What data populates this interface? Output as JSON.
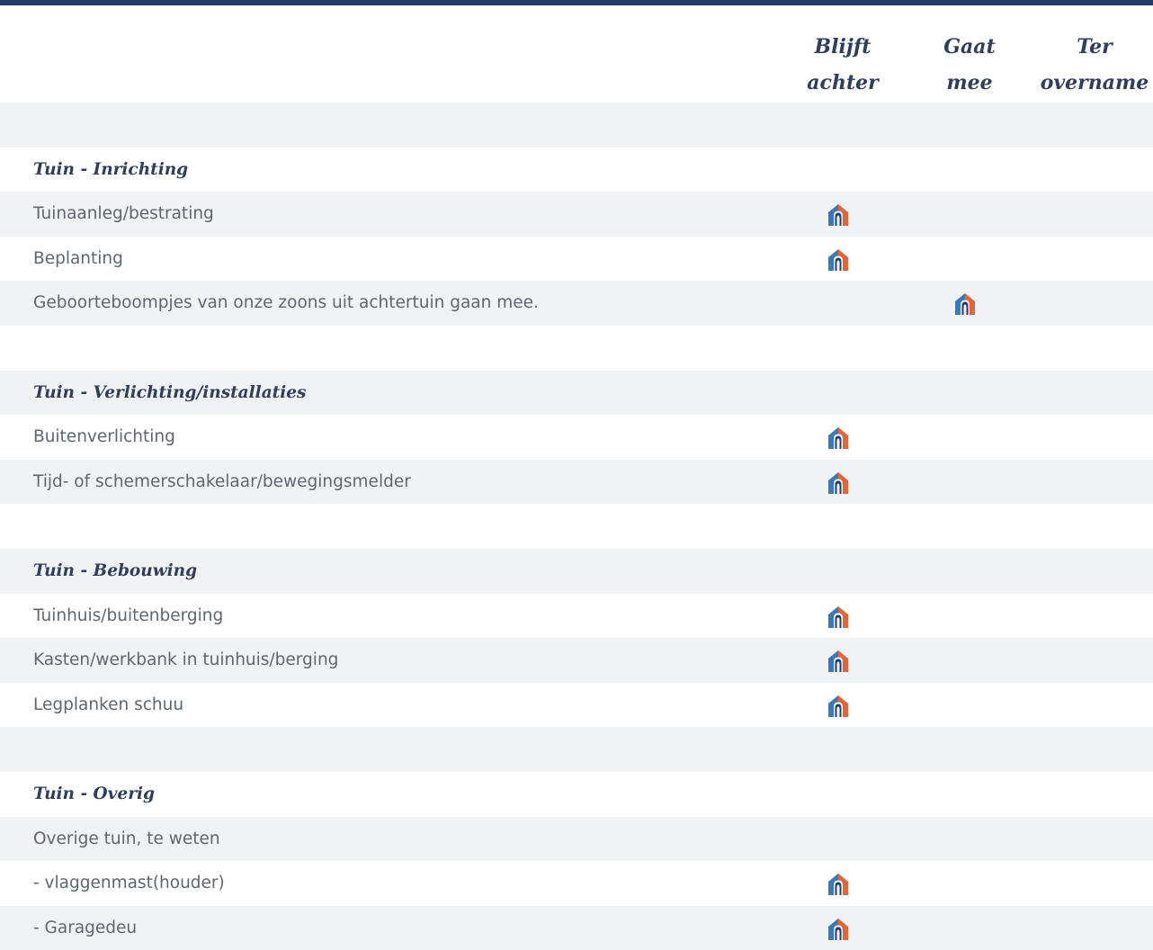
{
  "columns": [
    {
      "line1": "Blijft",
      "line2": "achter"
    },
    {
      "line1": "Gaat",
      "line2": "mee"
    },
    {
      "line1": "Ter",
      "line2": "overname"
    }
  ],
  "colors": {
    "topbar": "#243a66",
    "section_text": "#2e3e5c",
    "item_text": "#5f6670",
    "shade": "#f1f2f4",
    "icon_blue": "#3a78b8",
    "icon_orange": "#e0663a",
    "icon_navy": "#233c6b"
  },
  "icon_name": "house-check-icon",
  "rows": [
    {
      "kind": "spacer",
      "shade": true,
      "label": ""
    },
    {
      "kind": "section",
      "shade": false,
      "label": "Tuin - Inrichting"
    },
    {
      "kind": "item",
      "shade": true,
      "label": "Tuinaanleg/bestrating",
      "checked_column": 0
    },
    {
      "kind": "item",
      "shade": false,
      "label": "Beplanting",
      "checked_column": 0
    },
    {
      "kind": "item",
      "shade": true,
      "label": "Geboorteboompjes van onze zoons uit achtertuin gaan mee.",
      "checked_column": 1
    },
    {
      "kind": "spacer",
      "shade": false,
      "label": ""
    },
    {
      "kind": "section",
      "shade": true,
      "label": "Tuin - Verlichting/installaties"
    },
    {
      "kind": "item",
      "shade": false,
      "label": "Buitenverlichting",
      "checked_column": 0
    },
    {
      "kind": "item",
      "shade": true,
      "label": "Tijd- of schemerschakelaar/bewegingsmelder",
      "checked_column": 0
    },
    {
      "kind": "spacer",
      "shade": false,
      "label": ""
    },
    {
      "kind": "section",
      "shade": true,
      "label": "Tuin - Bebouwing"
    },
    {
      "kind": "item",
      "shade": false,
      "label": "Tuinhuis/buitenberging",
      "checked_column": 0
    },
    {
      "kind": "item",
      "shade": true,
      "label": "Kasten/werkbank in tuinhuis/berging",
      "checked_column": 0
    },
    {
      "kind": "item",
      "shade": false,
      "label": "Legplanken schuu",
      "checked_column": 0
    },
    {
      "kind": "spacer",
      "shade": true,
      "label": ""
    },
    {
      "kind": "section",
      "shade": false,
      "label": "Tuin - Overig"
    },
    {
      "kind": "item",
      "shade": true,
      "label": "Overige tuin, te weten",
      "checked_column": null
    },
    {
      "kind": "item",
      "shade": false,
      "label": " - vlaggenmast(houder)",
      "checked_column": 0
    },
    {
      "kind": "item",
      "shade": true,
      "label": " - Garagedeu",
      "checked_column": 0
    }
  ]
}
